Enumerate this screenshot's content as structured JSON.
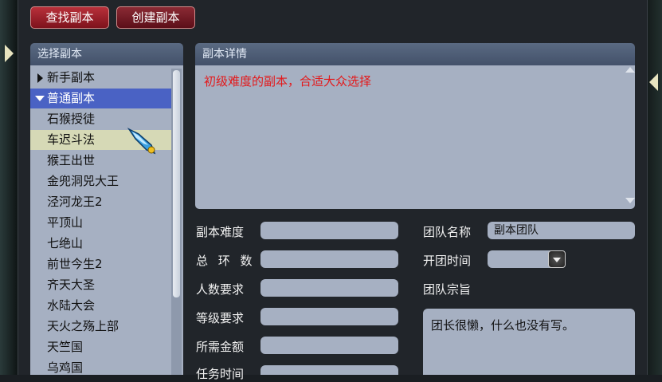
{
  "tabs": {
    "find_label": "查找副本",
    "create_label": "创建副本"
  },
  "list_panel": {
    "title": "选择副本",
    "categories": [
      {
        "label": "新手副本",
        "expanded": false
      },
      {
        "label": "普通副本",
        "expanded": true,
        "selected": true
      }
    ],
    "items": [
      "石猴授徒",
      "车迟斗法",
      "猴王出世",
      "金兜洞兕大王",
      "泾河龙王2",
      "平顶山",
      "七绝山",
      "前世今生2",
      "齐天大圣",
      "水陆大会",
      "天火之殇上部",
      "天竺国",
      "乌鸡国"
    ],
    "hovered_item": "车迟斗法"
  },
  "detail_panel": {
    "title": "副本详情",
    "description": "初级难度的副本，合适大众选择"
  },
  "form_left": {
    "difficulty_label": "副本难度",
    "rings_label": "总 环 数",
    "people_label": "人数要求",
    "level_label": "等级要求",
    "money_label": "所需金额",
    "time_label": "任务时间",
    "difficulty_value": "",
    "rings_value": "",
    "people_value": "",
    "level_value": "",
    "money_value": "",
    "time_value": ""
  },
  "form_right": {
    "team_name_label": "团队名称",
    "team_name_value": "副本团队",
    "open_time_label": "开团时间",
    "open_time_value": "",
    "motto_label": "团队宗旨",
    "motto_value": "团长很懒，什么也没有写。"
  },
  "colors": {
    "panel_bg": "#a6b0c2",
    "header_bg": "#4c5b74",
    "selected_row": "#4a62c4",
    "hover_row": "#d6d9b6",
    "description_text": "#e4181a",
    "tab_red": "#a11f2a"
  },
  "icons": {
    "cursor": "magic-wand-cursor-icon"
  }
}
